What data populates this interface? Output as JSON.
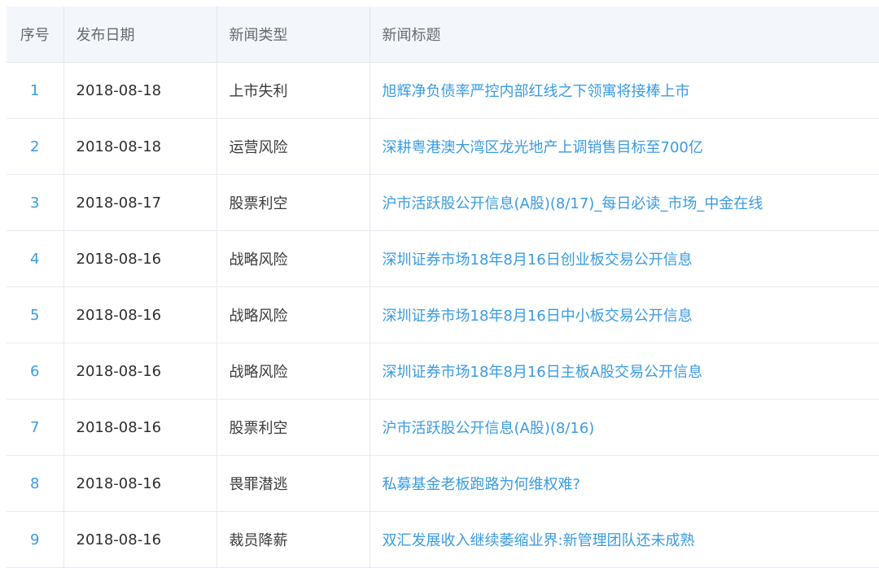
{
  "table": {
    "headers": {
      "index": "序号",
      "date": "发布日期",
      "type": "新闻类型",
      "title": "新闻标题"
    },
    "rows": [
      {
        "index": "1",
        "date": "2018-08-18",
        "type": "上市失利",
        "title": "旭辉净负债率严控内部红线之下领寓将接棒上市"
      },
      {
        "index": "2",
        "date": "2018-08-18",
        "type": "运营风险",
        "title": "深耕粤港澳大湾区龙光地产上调销售目标至700亿"
      },
      {
        "index": "3",
        "date": "2018-08-17",
        "type": "股票利空",
        "title": "沪市活跃股公开信息(A股)(8/17)_每日必读_市场_中金在线"
      },
      {
        "index": "4",
        "date": "2018-08-16",
        "type": "战略风险",
        "title": "深圳证券市场18年8月16日创业板交易公开信息"
      },
      {
        "index": "5",
        "date": "2018-08-16",
        "type": "战略风险",
        "title": "深圳证券市场18年8月16日中小板交易公开信息"
      },
      {
        "index": "6",
        "date": "2018-08-16",
        "type": "战略风险",
        "title": "深圳证券市场18年8月16日主板A股交易公开信息"
      },
      {
        "index": "7",
        "date": "2018-08-16",
        "type": "股票利空",
        "title": "沪市活跃股公开信息(A股)(8/16)"
      },
      {
        "index": "8",
        "date": "2018-08-16",
        "type": "畏罪潜逃",
        "title": "私募基金老板跑路为何维权难?"
      },
      {
        "index": "9",
        "date": "2018-08-16",
        "type": "裁员降薪",
        "title": "双汇发展收入继续萎缩业界:新管理团队还未成熟"
      }
    ]
  },
  "colors": {
    "header_bg": "#f3f7fc",
    "link": "#3a9be0",
    "border": "#e6ebf1"
  }
}
